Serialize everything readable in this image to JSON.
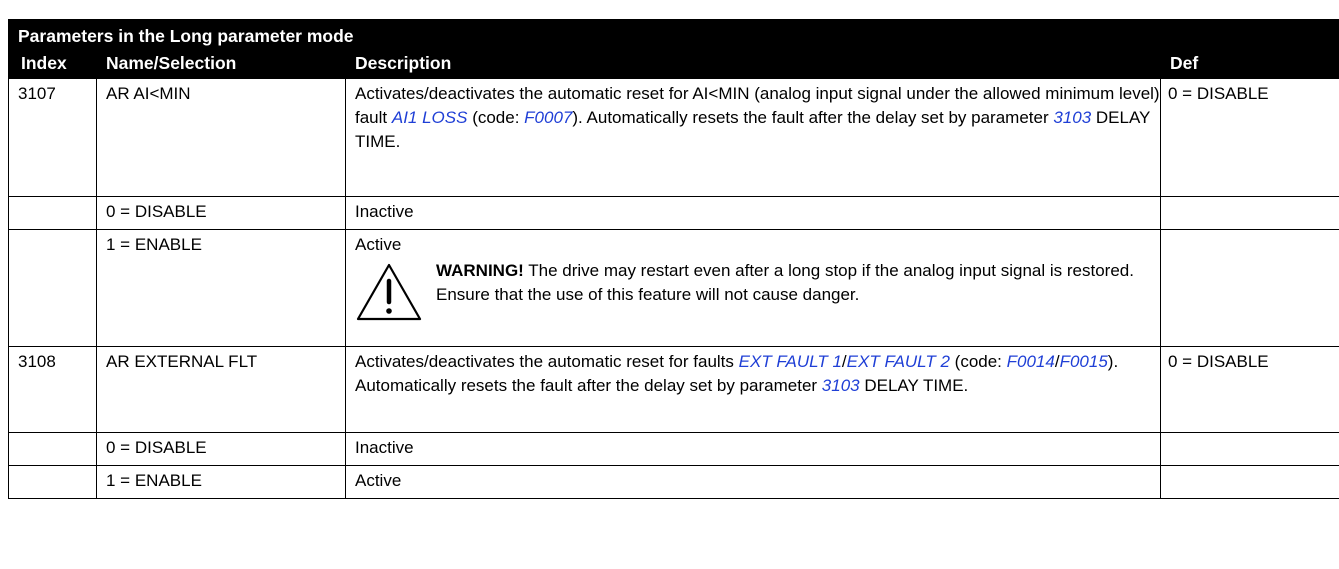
{
  "table": {
    "title": "Parameters in the Long parameter mode",
    "headers": {
      "index": "Index",
      "name": "Name/Selection",
      "description": "Description",
      "def": "Def"
    },
    "rows": [
      {
        "index": "3107",
        "name": "AR AI<MIN",
        "description_parts": {
          "p1": "Activates/deactivates the automatic reset for AI<MIN (analog input signal under the allowed minimum level) fault ",
          "link1": "AI1 LOSS",
          "p2": " (code: ",
          "link2": "F0007",
          "p3": "). Automatically resets the fault after the delay set by parameter ",
          "link3": "3103",
          "p4": " DELAY TIME."
        },
        "def": "0 = DISABLE"
      },
      {
        "index": "",
        "name": "0 = DISABLE",
        "description": "Inactive",
        "def": ""
      },
      {
        "index": "",
        "name": "1 = ENABLE",
        "description": "Active",
        "warning": {
          "label": "WARNING!",
          "text": " The drive may restart even after a long stop if the analog input signal is restored. Ensure that the use of this feature will not cause danger."
        },
        "def": ""
      },
      {
        "index": "3108",
        "name": "AR EXTERNAL FLT",
        "description_parts": {
          "p1": "Activates/deactivates the automatic reset for faults ",
          "link1": "EXT FAULT 1",
          "sep1": "/",
          "link2": "EXT FAULT 2",
          "p2": " (code: ",
          "link3": "F0014",
          "sep2": "/",
          "link4": "F0015",
          "p3": "). Automatically resets the fault after the delay set by parameter ",
          "link5": "3103",
          "p4": " DELAY TIME."
        },
        "def": "0 = DISABLE"
      },
      {
        "index": "",
        "name": "0 = DISABLE",
        "description": "Inactive",
        "def": ""
      },
      {
        "index": "",
        "name": "1 = ENABLE",
        "description": "Active",
        "def": ""
      }
    ]
  },
  "colors": {
    "header_bg": "#000000",
    "header_text": "#ffffff",
    "link": "#1f3fd6"
  },
  "icons": {
    "warning": "warning-triangle-icon"
  }
}
